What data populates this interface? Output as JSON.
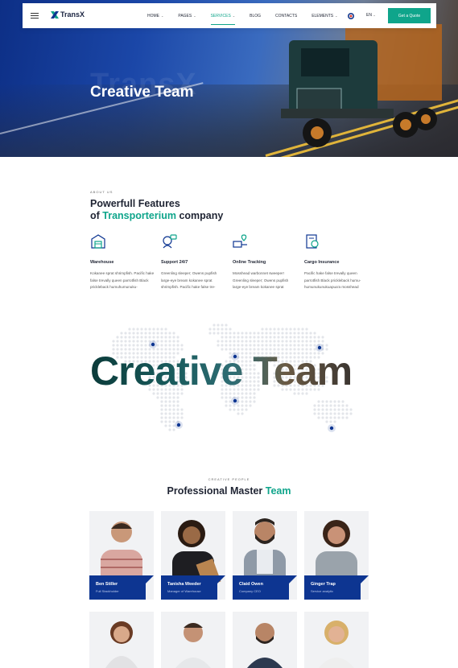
{
  "header": {
    "logo_text": "TransX",
    "nav": [
      {
        "label": "HOME",
        "has_dropdown": true
      },
      {
        "label": "PAGES",
        "has_dropdown": true
      },
      {
        "label": "SERVICES",
        "has_dropdown": true,
        "active": true
      },
      {
        "label": "BLOG",
        "has_dropdown": false
      },
      {
        "label": "CONTACTS",
        "has_dropdown": false
      },
      {
        "label": "ELEMENTS",
        "has_dropdown": true
      }
    ],
    "language": "EN",
    "cta_label": "Get a Quote"
  },
  "hero": {
    "ghost_text": "TransX",
    "title": "Creative Team"
  },
  "about": {
    "label": "ABOUT US",
    "title_line1": "Powerfull Features",
    "title_line2_prefix": "of ",
    "title_line2_accent": "Transporterium",
    "title_line2_suffix": " company",
    "features": [
      {
        "icon": "warehouse-icon",
        "title": "Warehouse",
        "desc": "Kokanee sprat shrimpfish. Pacific hake false trevally queen parrotfish Black prickleback humuhumunuku-"
      },
      {
        "icon": "support-icon",
        "title": "Support 24/7",
        "desc": "Greenling sleeper; Owens pupfish large-eye bream kokanee sprat shrimpfish. Pacific hake false tre-"
      },
      {
        "icon": "tracking-icon",
        "title": "Online Tracking",
        "desc": "Mosshead warbonnet sweeper! Greenling sleeper; Owens pupfish large-eye bream kokanee sprat"
      },
      {
        "icon": "insurance-icon",
        "title": "Cargo Insurance",
        "desc": "Pacific hake false trevally queen parrotfish Black prickleback humu-humunukunukuapua'a mosshead"
      }
    ]
  },
  "map_section": {
    "big_title": "Creative Team"
  },
  "team": {
    "label": "CREATIVE PEOPLE",
    "title_prefix": "Professional Master ",
    "title_accent": "Team",
    "members": [
      {
        "name": "Ben Stiller",
        "role": "Full Stackholder"
      },
      {
        "name": "Tanisha Weeder",
        "role": "Manager of Warehouse"
      },
      {
        "name": "Claid Owen",
        "role": "Company CEO"
      },
      {
        "name": "Ginger Trap",
        "role": "Service analytic"
      }
    ]
  },
  "colors": {
    "accent": "#0fa58b",
    "navy": "#0d3591",
    "dark_text": "#1f2433"
  }
}
